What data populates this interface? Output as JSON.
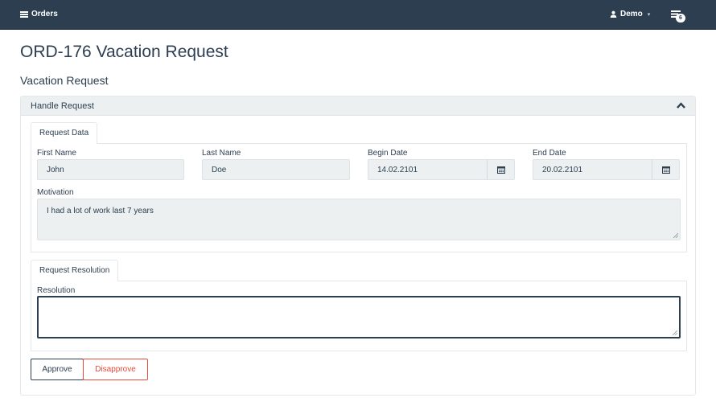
{
  "navbar": {
    "brand_label": "Orders",
    "user_label": "Demo",
    "notification_count": "6"
  },
  "page": {
    "title": "ORD-176 Vacation Request",
    "section_title": "Vacation Request"
  },
  "panel": {
    "header_label": "Handle Request"
  },
  "request_data": {
    "tab_label": "Request Data",
    "first_name_label": "First Name",
    "first_name_value": "John",
    "last_name_label": "Last Name",
    "last_name_value": "Doe",
    "begin_date_label": "Begin Date",
    "begin_date_value": "14.02.2101",
    "end_date_label": "End Date",
    "end_date_value": "20.02.2101",
    "motivation_label": "Motivation",
    "motivation_value": "I had a lot of work last 7 years"
  },
  "request_resolution": {
    "tab_label": "Request Resolution",
    "resolution_label": "Resolution",
    "resolution_value": ""
  },
  "actions": {
    "approve_label": "Approve",
    "disapprove_label": "Disapprove"
  },
  "icons": {
    "brand": "list-icon",
    "user": "user-icon",
    "notifications": "notifications-icon",
    "collapse": "chevron-up-icon",
    "date_picker": "calendar-icon"
  },
  "colors": {
    "navbar_bg": "#2c3e50",
    "field_bg": "#ecf0f1",
    "danger": "#e74c3c"
  }
}
